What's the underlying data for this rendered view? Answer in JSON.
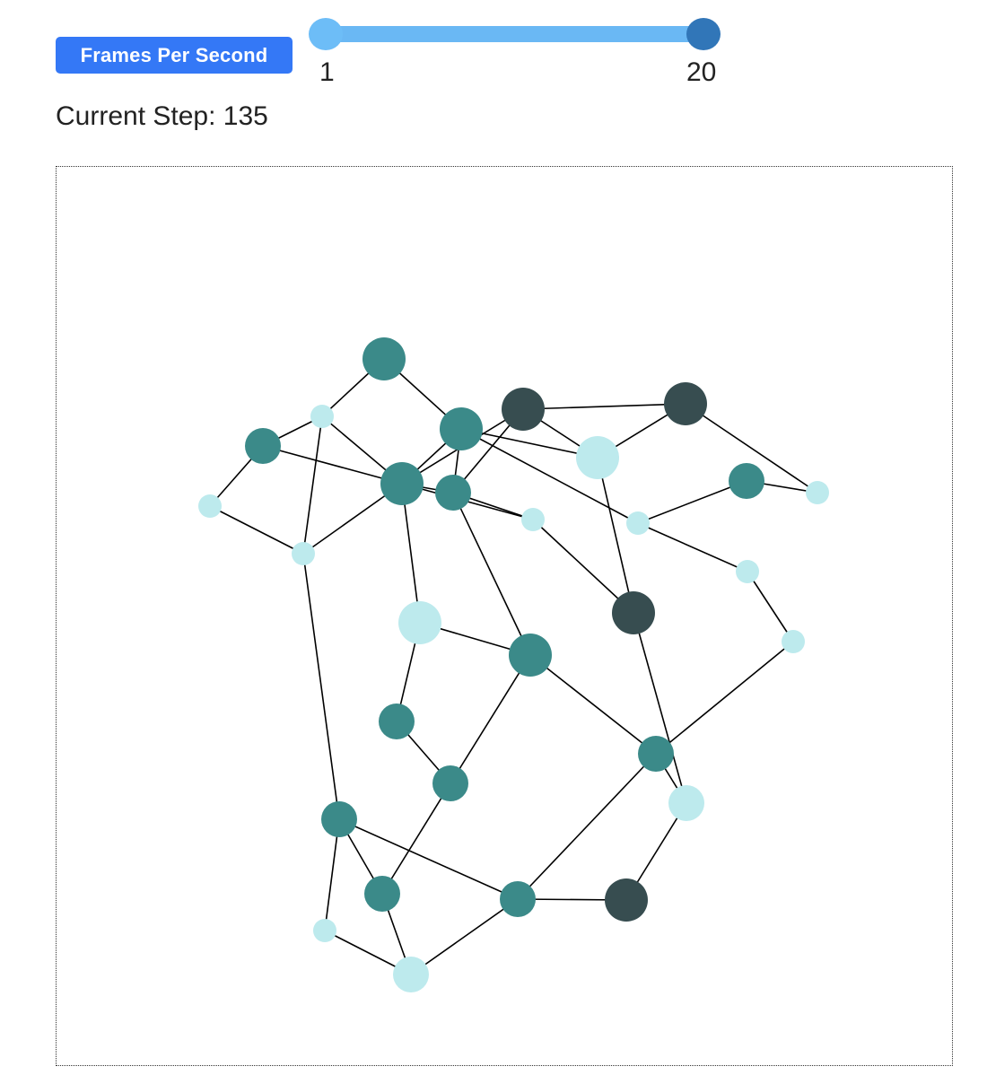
{
  "controls": {
    "fps_label": "Frames Per Second",
    "slider": {
      "min_label": "1",
      "max_label": "20",
      "min": 1,
      "max": 20,
      "value_low": 1,
      "value_high": 20
    },
    "step_label": "Current Step:",
    "step_value": "135"
  },
  "colors": {
    "accent": "#3478f6",
    "slider_track": "#6ab8f4",
    "node_light": "#bdeaed",
    "node_teal": "#3b8a89",
    "node_dark": "#374d50",
    "edge": "#000000"
  },
  "graph": {
    "nodes": [
      {
        "id": 0,
        "type": "teal",
        "size": "large"
      },
      {
        "id": 1,
        "type": "light",
        "size": "small"
      },
      {
        "id": 2,
        "type": "teal",
        "size": "medium"
      },
      {
        "id": 3,
        "type": "light",
        "size": "small"
      },
      {
        "id": 4,
        "type": "light",
        "size": "small"
      },
      {
        "id": 5,
        "type": "teal",
        "size": "large"
      },
      {
        "id": 6,
        "type": "teal",
        "size": "large"
      },
      {
        "id": 7,
        "type": "teal",
        "size": "medium"
      },
      {
        "id": 8,
        "type": "dark",
        "size": "large"
      },
      {
        "id": 9,
        "type": "dark",
        "size": "large"
      },
      {
        "id": 10,
        "type": "light",
        "size": "large"
      },
      {
        "id": 11,
        "type": "teal",
        "size": "medium"
      },
      {
        "id": 12,
        "type": "light",
        "size": "small"
      },
      {
        "id": 13,
        "type": "light",
        "size": "small"
      },
      {
        "id": 14,
        "type": "light",
        "size": "small"
      },
      {
        "id": 15,
        "type": "light",
        "size": "small"
      },
      {
        "id": 16,
        "type": "dark",
        "size": "large"
      },
      {
        "id": 17,
        "type": "light",
        "size": "small"
      },
      {
        "id": 18,
        "type": "light",
        "size": "large"
      },
      {
        "id": 19,
        "type": "teal",
        "size": "large"
      },
      {
        "id": 20,
        "type": "teal",
        "size": "medium"
      },
      {
        "id": 21,
        "type": "teal",
        "size": "medium"
      },
      {
        "id": 22,
        "type": "teal",
        "size": "medium"
      },
      {
        "id": 23,
        "type": "light",
        "size": "medium"
      },
      {
        "id": 24,
        "type": "teal",
        "size": "medium"
      },
      {
        "id": 25,
        "type": "teal",
        "size": "medium"
      },
      {
        "id": 26,
        "type": "teal",
        "size": "medium"
      },
      {
        "id": 27,
        "type": "dark",
        "size": "large"
      },
      {
        "id": 28,
        "type": "light",
        "size": "small"
      },
      {
        "id": 29,
        "type": "light",
        "size": "medium"
      }
    ],
    "edges": [
      [
        0,
        1
      ],
      [
        0,
        5
      ],
      [
        1,
        2
      ],
      [
        1,
        4
      ],
      [
        1,
        6
      ],
      [
        2,
        3
      ],
      [
        2,
        6
      ],
      [
        3,
        4
      ],
      [
        4,
        6
      ],
      [
        5,
        6
      ],
      [
        5,
        7
      ],
      [
        5,
        10
      ],
      [
        5,
        13
      ],
      [
        6,
        7
      ],
      [
        6,
        18
      ],
      [
        7,
        12
      ],
      [
        7,
        19
      ],
      [
        8,
        9
      ],
      [
        8,
        7
      ],
      [
        8,
        10
      ],
      [
        9,
        10
      ],
      [
        9,
        15
      ],
      [
        10,
        16
      ],
      [
        11,
        13
      ],
      [
        11,
        15
      ],
      [
        12,
        16
      ],
      [
        13,
        14
      ],
      [
        14,
        17
      ],
      [
        17,
        22
      ],
      [
        18,
        19
      ],
      [
        18,
        20
      ],
      [
        19,
        21
      ],
      [
        19,
        22
      ],
      [
        20,
        21
      ],
      [
        21,
        25
      ],
      [
        22,
        26
      ],
      [
        22,
        23
      ],
      [
        23,
        27
      ],
      [
        16,
        23
      ],
      [
        24,
        25
      ],
      [
        24,
        26
      ],
      [
        24,
        28
      ],
      [
        25,
        29
      ],
      [
        26,
        27
      ],
      [
        26,
        29
      ],
      [
        28,
        29
      ],
      [
        4,
        24
      ],
      [
        6,
        8
      ],
      [
        12,
        6
      ]
    ]
  }
}
